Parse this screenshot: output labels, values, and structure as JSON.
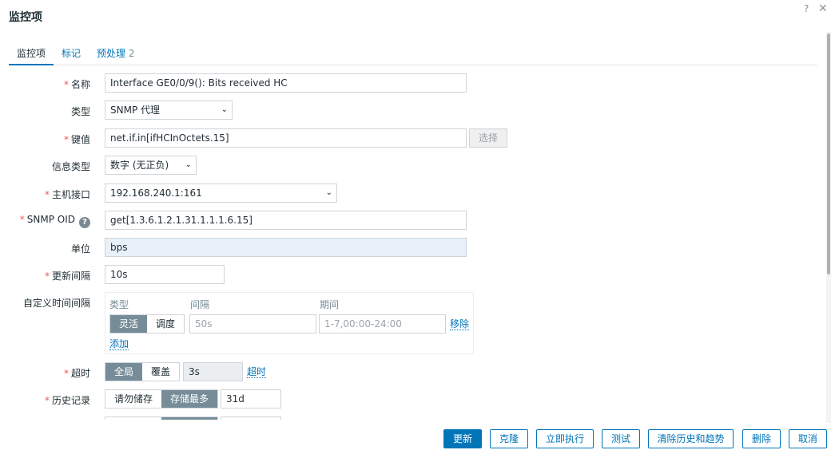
{
  "dialog": {
    "title": "监控项",
    "help": "?",
    "close": "✕"
  },
  "tabs": [
    {
      "label": "监控项",
      "badge": ""
    },
    {
      "label": "标记",
      "badge": ""
    },
    {
      "label": "预处理",
      "badge": "2"
    }
  ],
  "form": {
    "name": {
      "label": "名称",
      "value": "Interface GE0/0/9(): Bits received HC"
    },
    "type": {
      "label": "类型",
      "value": "SNMP 代理"
    },
    "key": {
      "label": "键值",
      "value": "net.if.in[ifHCInOctets.15]",
      "button": "选择"
    },
    "info_type": {
      "label": "信息类型",
      "value": "数字 (无正负)"
    },
    "host_interface": {
      "label": "主机接口",
      "value": "192.168.240.1:161"
    },
    "snmp_oid": {
      "label": "SNMP OID",
      "value": "get[1.3.6.1.2.1.31.1.1.1.6.15]",
      "help": "?"
    },
    "units": {
      "label": "单位",
      "value": "bps"
    },
    "update_interval": {
      "label": "更新间隔",
      "value": "10s"
    },
    "custom_intervals": {
      "label": "自定义时间间隔",
      "col_type": "类型",
      "col_interval": "间隔",
      "col_period": "期间",
      "flexible": "灵活",
      "scheduling": "调度",
      "interval_placeholder": "50s",
      "period_placeholder": "1-7,00:00-24:00",
      "remove": "移除",
      "add": "添加"
    },
    "timeout": {
      "label": "超时",
      "global": "全局",
      "override": "覆盖",
      "value": "3s",
      "link": "超时"
    },
    "history": {
      "label": "历史记录",
      "do_not_store": "请勿储存",
      "store_up_to": "存储最多",
      "value": "31d"
    }
  },
  "footer": {
    "update": "更新",
    "clone": "克隆",
    "execute_now": "立即执行",
    "test": "测试",
    "clear_history": "清除历史和趋势",
    "delete": "删除",
    "cancel": "取消"
  }
}
